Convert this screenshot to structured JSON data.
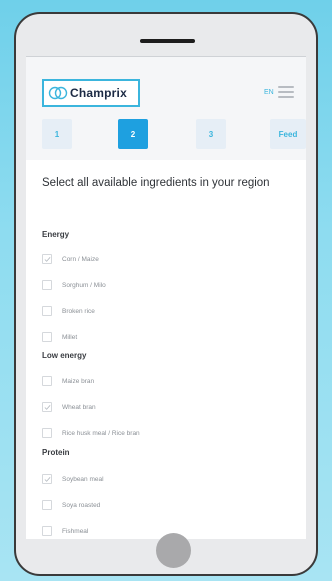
{
  "header": {
    "logo_text": "Champrix",
    "language": "EN"
  },
  "steps": [
    {
      "label": "1",
      "active": false
    },
    {
      "label": "2",
      "active": true
    },
    {
      "label": "3",
      "active": false
    },
    {
      "label": "Feed",
      "active": false
    }
  ],
  "question": "Select all available ingredients in your region",
  "sections": [
    {
      "title": "Energy",
      "items": [
        {
          "label": "Corn / Maize",
          "checked": true
        },
        {
          "label": "Sorghum / Milo",
          "checked": false
        },
        {
          "label": "Broken rice",
          "checked": false
        },
        {
          "label": "Millet",
          "checked": false
        }
      ]
    },
    {
      "title": "Low energy",
      "items": [
        {
          "label": "Maize bran",
          "checked": false
        },
        {
          "label": "Wheat bran",
          "checked": true
        },
        {
          "label": "Rice husk meal / Rice bran",
          "checked": false
        }
      ]
    },
    {
      "title": "Protein",
      "items": [
        {
          "label": "Soybean meal",
          "checked": true
        },
        {
          "label": "Soya roasted",
          "checked": false
        },
        {
          "label": "Fishmeal",
          "checked": false
        }
      ]
    }
  ],
  "colors": {
    "accent": "#1ea0e0",
    "accent_light": "#3bb5dd",
    "step_inactive_bg": "#e6eef6"
  }
}
